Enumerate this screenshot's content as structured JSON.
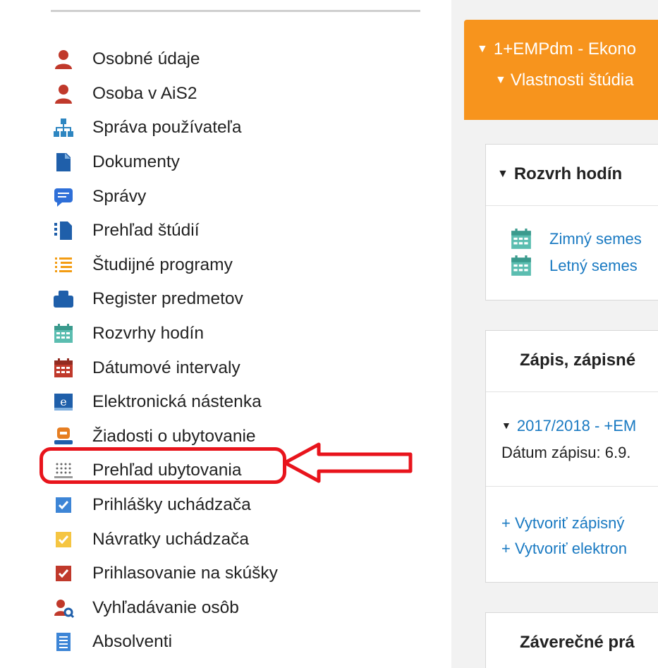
{
  "menu": [
    {
      "label": "Osobné údaje",
      "icon": "person-icon"
    },
    {
      "label": "Osoba v AiS2",
      "icon": "person-icon"
    },
    {
      "label": "Správa používateľa",
      "icon": "sitemap-icon"
    },
    {
      "label": "Dokumenty",
      "icon": "document-icon"
    },
    {
      "label": "Správy",
      "icon": "message-icon"
    },
    {
      "label": "Prehľad štúdií",
      "icon": "study-overview-icon"
    },
    {
      "label": "Študijné programy",
      "icon": "list-icon"
    },
    {
      "label": "Register predmetov",
      "icon": "register-icon"
    },
    {
      "label": "Rozvrhy hodín",
      "icon": "calendar-icon"
    },
    {
      "label": "Dátumové intervaly",
      "icon": "calendar-red-icon"
    },
    {
      "label": "Elektronická nástenka",
      "icon": "e-board-icon"
    },
    {
      "label": "Žiadosti o ubytovanie",
      "icon": "accommodation-request-icon"
    },
    {
      "label": "Prehľad ubytovania",
      "icon": "accommodation-overview-icon"
    },
    {
      "label": "Prihlášky uchádzača",
      "icon": "checkbox-blue-icon"
    },
    {
      "label": "Návratky uchádzača",
      "icon": "checkbox-yellow-icon"
    },
    {
      "label": "Prihlasovanie na skúšky",
      "icon": "checkbox-red-icon"
    },
    {
      "label": "Vyhľadávanie osôb",
      "icon": "person-search-icon"
    },
    {
      "label": "Absolventi",
      "icon": "graduate-list-icon"
    }
  ],
  "header": {
    "line1": "1+EMPdm - Ekono",
    "line2": "Vlastnosti štúdia"
  },
  "schedule": {
    "title": "Rozvrh hodín",
    "winter": "Zimný semes",
    "summer": "Letný semes"
  },
  "enrollment": {
    "title": "Zápis, zápisné",
    "year": "2017/2018 - +EM",
    "date_label": "Dátum zápisu: 6.9.",
    "create1": "+ Vytvoriť zápisný",
    "create2": "+ Vytvoriť elektron"
  },
  "final": {
    "title": "Záverečné prá"
  },
  "colors": {
    "accent_orange": "#f7941d",
    "link_blue": "#1a7ac2",
    "highlight_red": "#e8141c"
  }
}
